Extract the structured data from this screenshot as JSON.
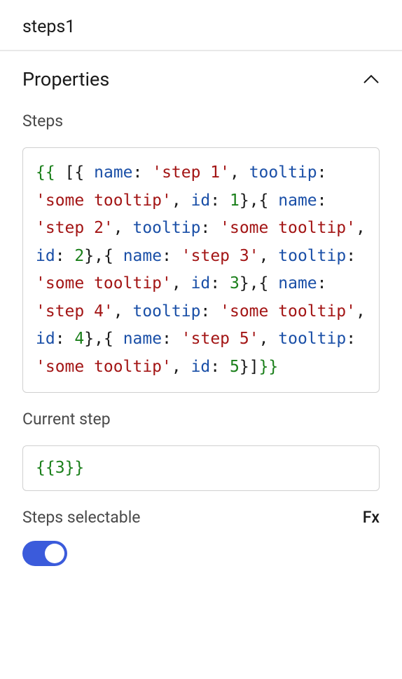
{
  "header": {
    "title": "steps1"
  },
  "section": {
    "title": "Properties"
  },
  "fields": {
    "steps": {
      "label": "Steps",
      "value": {
        "raw": "{{ [{ name: 'step 1', tooltip: 'some tooltip', id: 1},{ name: 'step 2', tooltip: 'some tooltip', id: 2},{ name: 'step 3', tooltip: 'some tooltip', id: 3},{ name: 'step 4', tooltip: 'some tooltip', id: 4},{ name: 'step 5', tooltip: 'some tooltip', id: 5}]}}",
        "items": [
          {
            "name": "step 1",
            "tooltip": "some tooltip",
            "id": 1
          },
          {
            "name": "step 2",
            "tooltip": "some tooltip",
            "id": 2
          },
          {
            "name": "step 3",
            "tooltip": "some tooltip",
            "id": 3
          },
          {
            "name": "step 4",
            "tooltip": "some tooltip",
            "id": 4
          },
          {
            "name": "step 5",
            "tooltip": "some tooltip",
            "id": 5
          }
        ]
      }
    },
    "currentStep": {
      "label": "Current step",
      "value": {
        "raw": "{{3}}",
        "expr": 3
      }
    },
    "stepsSelectable": {
      "label": "Steps selectable",
      "fxLabel": "Fx",
      "value": true
    }
  },
  "tokens": {
    "lbrace2": "{{",
    "rbrace2": "}}",
    "lbrace2sp": "{{ ",
    "lbracket": "[",
    "rbracket": "]",
    "lcurly": "{",
    "rcurly": "}",
    "name": "name",
    "tooltip": "tooltip",
    "id": "id",
    "colon": ": ",
    "colon2": ":",
    "comma": ", ",
    "commaNb": ",",
    "rcurlyComma": "},",
    "step1": "'step 1'",
    "step2": "'step 2'",
    "step3": "'step 3'",
    "step4": "'step 4'",
    "step5": "'step 5'",
    "someTooltip": "'some tooltip'",
    "n1": "1",
    "n2": "2",
    "n3": "3",
    "n4": "4",
    "n5": "5"
  }
}
